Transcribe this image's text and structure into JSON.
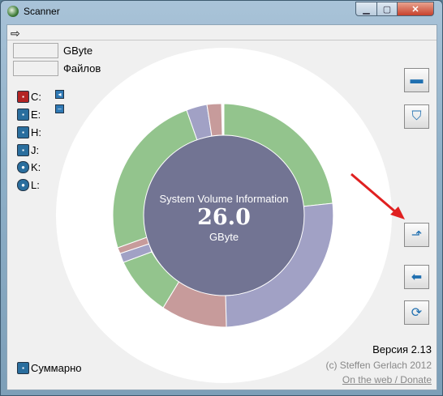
{
  "window": {
    "title": "Scanner"
  },
  "menu": {
    "arrow_glyph": "⇨"
  },
  "fields": {
    "size_unit": "GByte",
    "files_label": "Файлов"
  },
  "drives": [
    {
      "label": "C:",
      "icon": "drive-red-icon"
    },
    {
      "label": "E:",
      "icon": "drive-blue-icon"
    },
    {
      "label": "H:",
      "icon": "drive-blue-icon"
    },
    {
      "label": "J:",
      "icon": "drive-blue-icon"
    },
    {
      "label": "K:",
      "icon": "cd-icon"
    },
    {
      "label": "L:",
      "icon": "cd-icon"
    }
  ],
  "center": {
    "title": "System Volume Information",
    "value": "26.0",
    "unit": "GByte"
  },
  "footer": {
    "version": "Версия 2.13",
    "copyright": "(c) Steffen Gerlach 2012",
    "web_link": "On the web / Donate",
    "summary_label": "Суммарно"
  },
  "colors": {
    "center": "#727493",
    "green": "#93c48d",
    "lavender": "#a1a1c5",
    "pink": "#c79b9b"
  }
}
